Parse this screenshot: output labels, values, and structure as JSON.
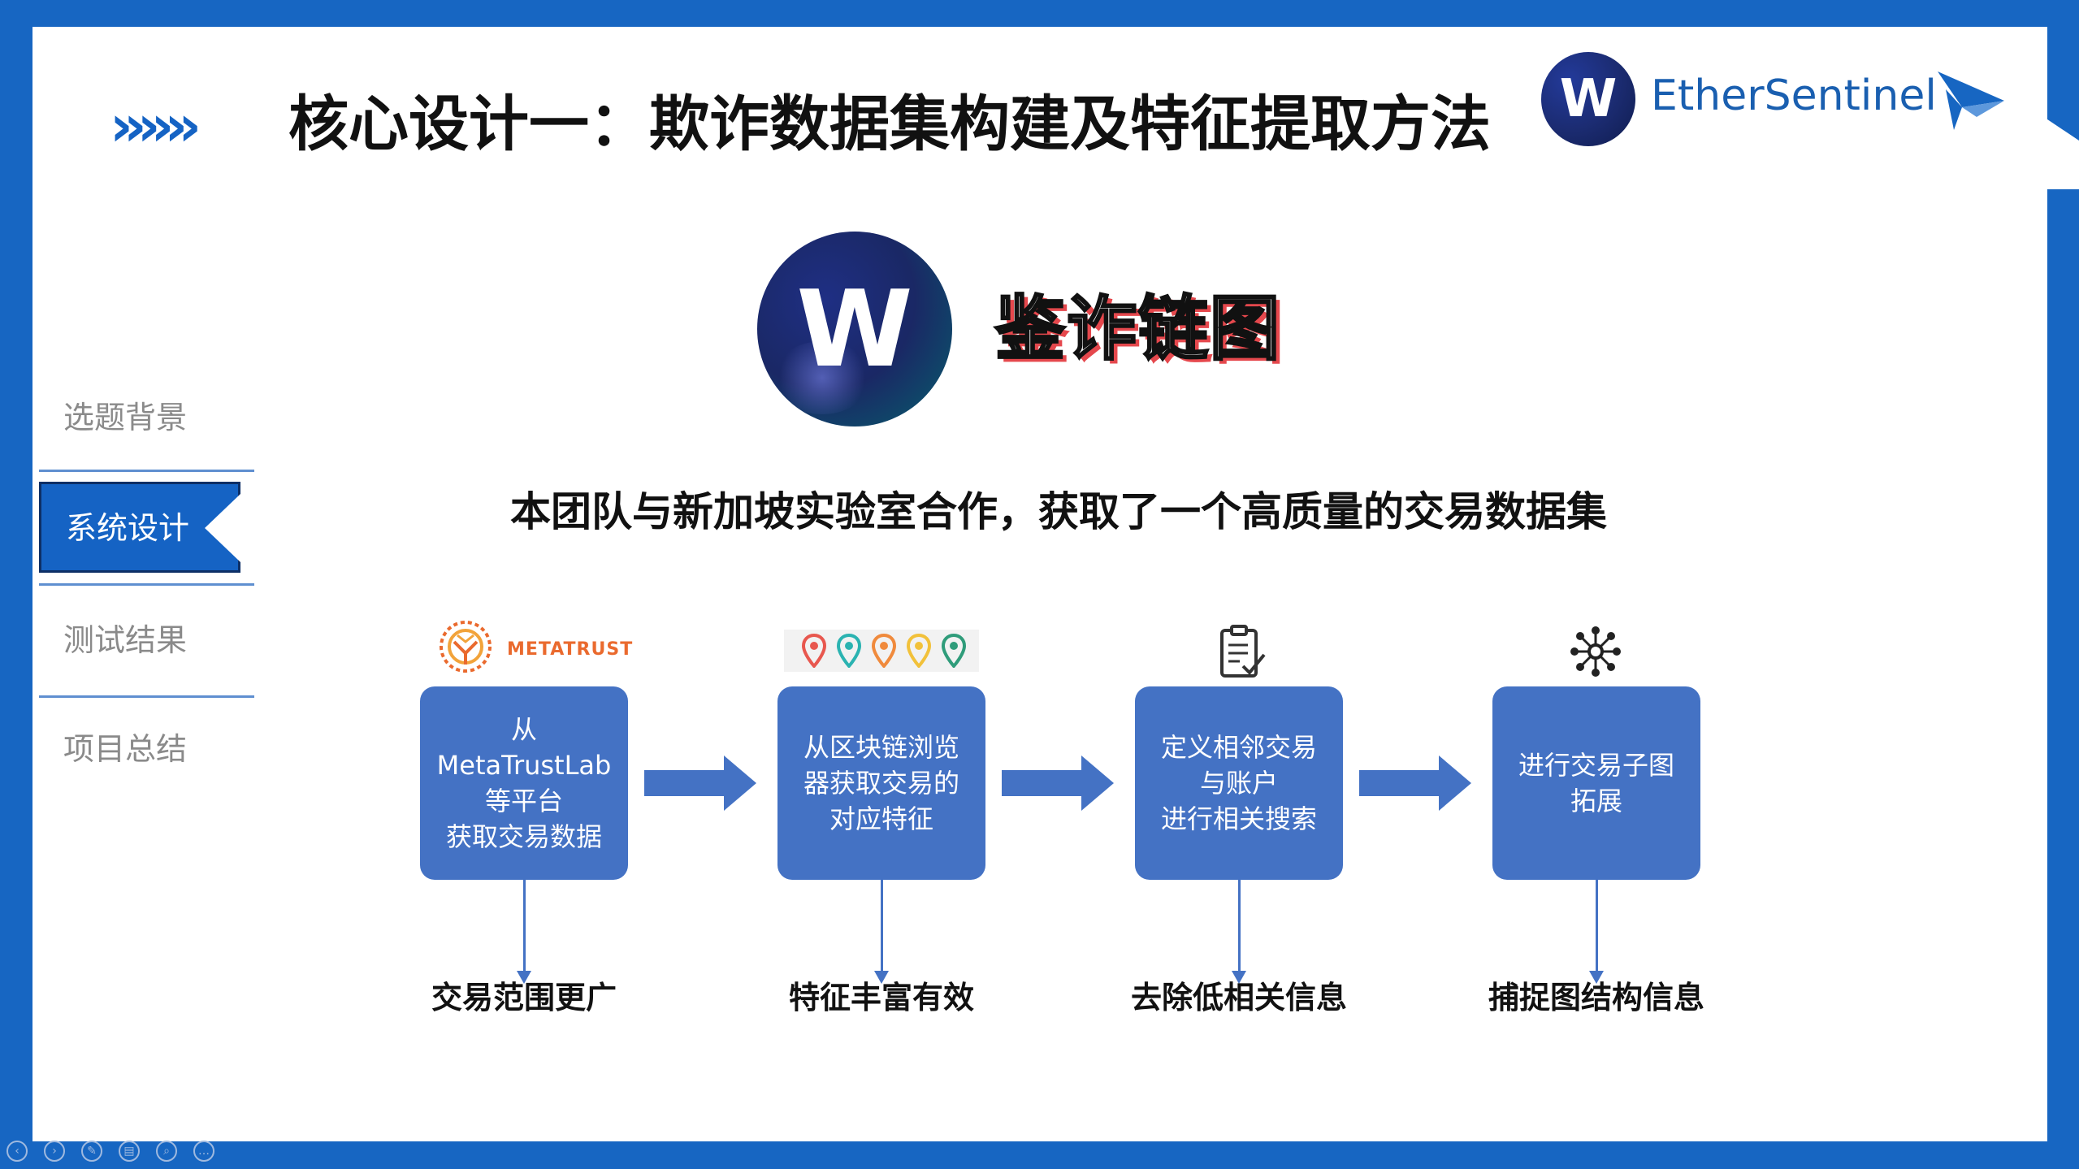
{
  "header": {
    "chevrons": "››››››",
    "title": "核心设计一：欺诈数据集构建及特征提取方法",
    "brand_logo_letter": "W",
    "brand_name": "EtherSentinel"
  },
  "hero": {
    "logo_letter": "W",
    "product_name": "鉴诈链图"
  },
  "subtitle": "本团队与新加坡实验室合作，获取了一个高质量的交易数据集",
  "sidebar": {
    "items": [
      {
        "label": "选题背景",
        "active": false
      },
      {
        "label": "系统设计",
        "active": true
      },
      {
        "label": "测试结果",
        "active": false
      },
      {
        "label": "项目总结",
        "active": false
      }
    ]
  },
  "flow": {
    "partner_logo_text": "METATRUST",
    "steps": [
      {
        "text": "从MetaTrustLab\n等平台\n获取交易数据",
        "result": "交易范围更广",
        "icon": "metatrust-logo"
      },
      {
        "text": "从区块链浏览\n器获取交易的\n对应特征",
        "result": "特征丰富有效",
        "icon": "map-pins-icon"
      },
      {
        "text": "定义相邻交易\n与账户\n进行相关搜索",
        "result": "去除低相关信息",
        "icon": "clipboard-check-icon"
      },
      {
        "text": "进行交易子图\n拓展",
        "result": "捕捉图结构信息",
        "icon": "network-icon"
      }
    ]
  },
  "colors": {
    "frame_blue": "#1766c2",
    "box_blue": "#4472c4",
    "accent_red": "#e5484d",
    "pin_colors": [
      "#e8574e",
      "#2bb3b1",
      "#f08a3c",
      "#f2c13a",
      "#2f9c7a"
    ]
  },
  "controls": [
    "prev-icon",
    "next-icon",
    "pen-icon",
    "slides-icon",
    "zoom-icon",
    "more-icon"
  ]
}
